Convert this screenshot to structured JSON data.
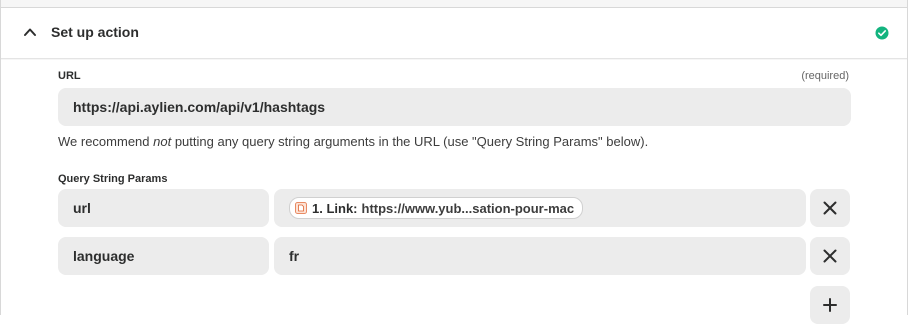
{
  "section": {
    "title": "Set up action",
    "status_color": "#13b47f",
    "chevron_icon": "chevron-up-icon",
    "status_icon": "check-circle-icon"
  },
  "url_field": {
    "label": "URL",
    "required_text": "(required)",
    "value": "https://api.aylien.com/api/v1/hashtags",
    "help_before": "We recommend ",
    "help_emphasis": "not",
    "help_after": " putting any query string arguments in the URL (use \"Query String Params\" below)."
  },
  "query_params": {
    "label": "Query String Params",
    "rows": [
      {
        "key": "url",
        "pill_label": "1. Link:",
        "pill_value": "https://www.yub...sation-pour-mac",
        "pill_icon": "document-icon"
      },
      {
        "key": "language",
        "value": "fr"
      }
    ],
    "remove_icon": "close-icon",
    "add_icon": "plus-icon"
  }
}
